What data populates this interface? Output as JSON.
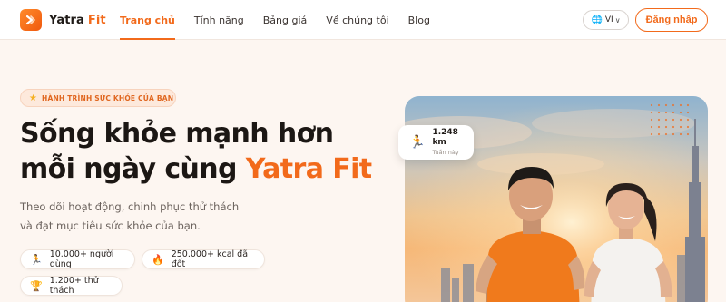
{
  "brand": {
    "name_part1": "Yatra",
    "name_part2": "Fit"
  },
  "nav": {
    "links": [
      {
        "label": "Trang chủ",
        "active": true
      },
      {
        "label": "Tính năng",
        "active": false
      },
      {
        "label": "Bảng giá",
        "active": false
      },
      {
        "label": "Về chúng tôi",
        "active": false
      },
      {
        "label": "Blog",
        "active": false
      }
    ],
    "language": "VI",
    "login_label": "Đăng nhập"
  },
  "hero": {
    "badge": "HÀNH TRÌNH SỨC KHỎE CỦA BẠN",
    "headline_line1": "Sống khỏe mạnh hơn",
    "headline_line2_prefix": "mỗi ngày cùng",
    "headline_accent": "Yatra Fit",
    "subtitle_line1": "Theo dõi hoạt động, chinh phục thử thách",
    "subtitle_line2": "và đạt mục tiêu sức khỏe của bạn.",
    "stats": [
      {
        "icon": "runner-icon",
        "label": "10.000+ người dùng"
      },
      {
        "icon": "fire-icon",
        "label": "250.000+ kcal đã đốt"
      },
      {
        "icon": "trophy-icon",
        "label": "1.200+ thử thách"
      }
    ]
  },
  "stat_card": {
    "value": "1.248 km",
    "label": "Tuần này"
  },
  "colors": {
    "accent": "#f26a1b",
    "background": "#fdf6f1",
    "text": "#1f1a17"
  }
}
